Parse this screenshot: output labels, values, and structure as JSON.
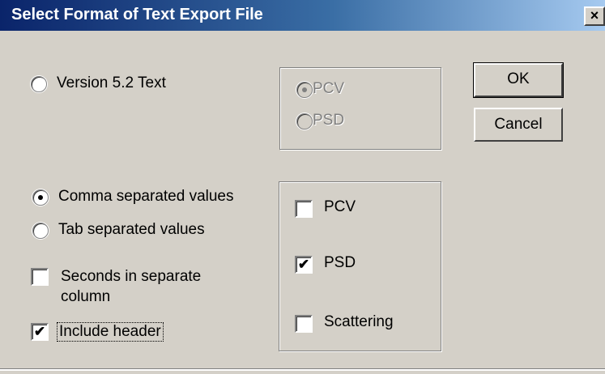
{
  "window": {
    "title": "Select Format of Text Export File",
    "close_symbol": "×",
    "close_icon": "close-icon"
  },
  "version_group": {
    "radio_label": "Version 5.2 Text",
    "radio_selected": false,
    "options": [
      {
        "label": "PCV",
        "selected": true,
        "enabled": false
      },
      {
        "label": "PSD",
        "selected": false,
        "enabled": false
      }
    ]
  },
  "separator_group": {
    "options": [
      {
        "label": "Comma separated values",
        "selected": true
      },
      {
        "label": "Tab separated values",
        "selected": false
      }
    ]
  },
  "options": {
    "seconds_label_line1": "Seconds in separate",
    "seconds_label_line2": "column",
    "seconds_checked": false,
    "include_header_label": "Include header",
    "include_header_checked": true,
    "check_glyph": "✔"
  },
  "output_group": {
    "items": [
      {
        "label": "PCV",
        "checked": false
      },
      {
        "label": "PSD",
        "checked": true
      },
      {
        "label": "Scattering",
        "checked": false
      }
    ]
  },
  "buttons": {
    "ok_label": "OK",
    "cancel_label": "Cancel"
  }
}
